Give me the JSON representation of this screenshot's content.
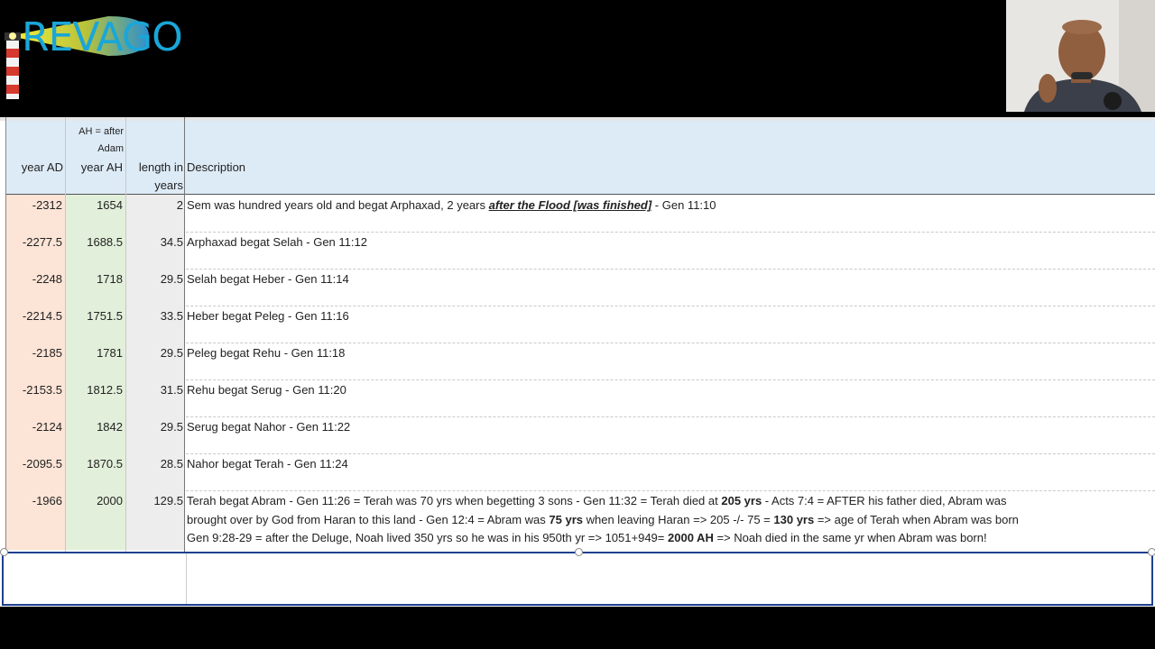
{
  "logo": {
    "text": "REVAGO"
  },
  "header": {
    "note": "AH = after Adam",
    "col_year_ad": "year AD",
    "col_year_ah": "year AH",
    "col_length": "length in years",
    "col_description": "Description"
  },
  "rows": [
    {
      "year_ad": "-2312",
      "year_ah": "1654",
      "length": "2",
      "d1": "Sem was hundred years old and begat Arphaxad, 2 years ",
      "d_em": "after the Flood [was finished]",
      "d2": " - Gen 11:10"
    },
    {
      "year_ad": "-2277.5",
      "year_ah": "1688.5",
      "length": "34.5",
      "desc": "Arphaxad begat Selah - Gen 11:12"
    },
    {
      "year_ad": "-2248",
      "year_ah": "1718",
      "length": "29.5",
      "desc": "Selah begat Heber - Gen 11:14"
    },
    {
      "year_ad": "-2214.5",
      "year_ah": "1751.5",
      "length": "33.5",
      "desc": "Heber begat Peleg - Gen 11:16"
    },
    {
      "year_ad": "-2185",
      "year_ah": "1781",
      "length": "29.5",
      "desc": "Peleg begat Rehu - Gen 11:18"
    },
    {
      "year_ad": "-2153.5",
      "year_ah": "1812.5",
      "length": "31.5",
      "desc": "Rehu begat Serug - Gen 11:20"
    },
    {
      "year_ad": "-2124",
      "year_ah": "1842",
      "length": "29.5",
      "desc": "Serug begat Nahor - Gen 11:22"
    },
    {
      "year_ad": "-2095.5",
      "year_ah": "1870.5",
      "length": "28.5",
      "desc": "Nahor begat Terah - Gen 11:24"
    }
  ],
  "last_row": {
    "year_ad": "-1966",
    "year_ah": "2000",
    "length": "129.5",
    "l1a": "Terah begat Abram - Gen 11:26 = Terah was 70 yrs when begetting 3 sons - Gen 11:32 = Terah died at ",
    "l1b": "205 yrs",
    "l1c": " - Acts 7:4 = AFTER his father died, Abram was",
    "l2a": "brought over by God from Haran to this land - Gen 12:4 = Abram was ",
    "l2b": "75 yrs",
    "l2c": " when leaving Haran => 205 -/- 75 = ",
    "l2d": "130 yrs",
    "l2e": " => age of Terah when Abram was born",
    "l3a": "Gen 9:28-29 = after the Deluge, Noah lived 350 yrs so he was in his 950th yr => 1051+949= ",
    "l3b": "2000 AH",
    "l3c": " => Noah died in the same yr when Abram was born!"
  }
}
